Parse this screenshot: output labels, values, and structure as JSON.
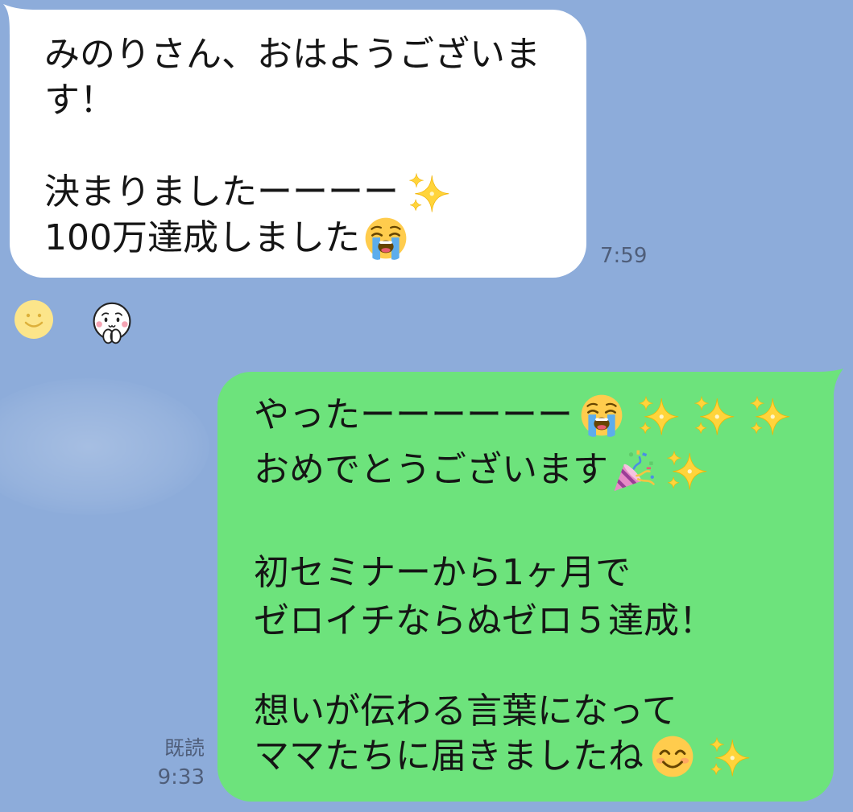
{
  "chat": {
    "background_color": "#8DACDA",
    "incoming_bubble_color": "#FFFFFF",
    "outgoing_bubble_color": "#6DE37C",
    "meta_text_color": "#4F5E7A"
  },
  "incoming_message": {
    "lines": [
      {
        "text": "みのりさん、おはようございま",
        "emoji": []
      },
      {
        "text": "す！",
        "emoji": []
      },
      {
        "text": "決まりましたーーーー",
        "emoji": [
          "sparkles"
        ]
      },
      {
        "text": "100万達成しました",
        "emoji": [
          "loudly-crying-face"
        ]
      }
    ],
    "time": "7:59",
    "reactions": [
      "add-reaction-smiley",
      "moved-face-sticker"
    ]
  },
  "outgoing_message": {
    "lines": [
      {
        "text": "やったーーーーーー",
        "emoji": [
          "loudly-crying-face",
          "sparkles",
          "sparkles",
          "sparkles"
        ]
      },
      {
        "text": "おめでとうございます",
        "emoji": [
          "party-popper",
          "sparkles"
        ]
      },
      {
        "text": "初セミナーから1ヶ月で",
        "emoji": []
      },
      {
        "text": "ゼロイチならぬゼロ５達成！",
        "emoji": []
      },
      {
        "text": "想いが伝わる言葉になって",
        "emoji": []
      },
      {
        "text": "ママたちに届きましたね",
        "emoji": [
          "smiling-face-with-smiling-eyes",
          "sparkles"
        ]
      }
    ],
    "read_status": "既読",
    "time": "9:33"
  }
}
